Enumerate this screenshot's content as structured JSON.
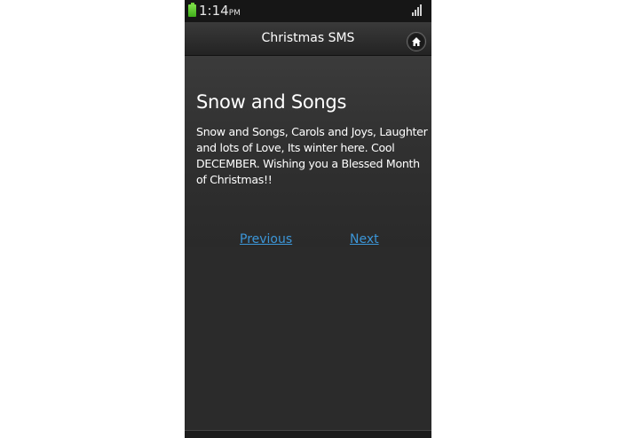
{
  "status_bar": {
    "time": "1:14",
    "ampm": "PM",
    "icons": [
      "battery-icon",
      "signal-icon"
    ]
  },
  "title_bar": {
    "title": "Christmas SMS",
    "home_icon": "home-icon"
  },
  "message": {
    "title": "Snow and Songs",
    "body": "Snow and Songs, Carols and Joys, Laughter and lots of Love, Its winter here. Cool DECEMBER. Wishing you a Blessed Month of Christmas!!"
  },
  "navigation": {
    "previous_label": "Previous",
    "next_label": "Next"
  },
  "colors": {
    "background": "#2c2c2c",
    "link": "#3c96d8",
    "battery": "#6fd13a"
  }
}
